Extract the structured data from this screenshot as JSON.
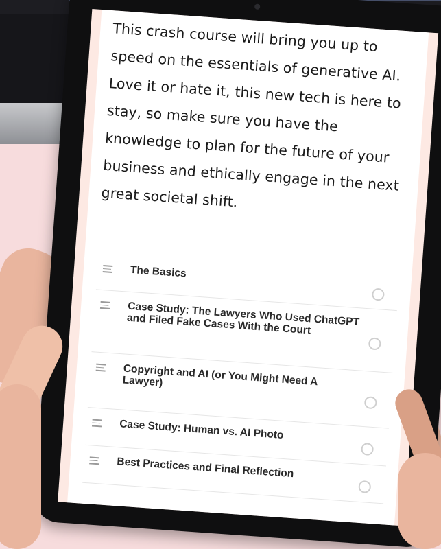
{
  "intro_text": "This crash course will bring you up to speed on the essentials of generative AI. Love it or hate it, this new tech is here to stay, so make sure you have the knowledge to plan for the future of your business and ethically engage in the next great societal shift.",
  "lessons": [
    {
      "title": "The Basics"
    },
    {
      "title": "Case Study: The Lawyers Who Used ChatGPT and Filed Fake Cases With the Court"
    },
    {
      "title": "Copyright and AI (or You Might Need A Lawyer)"
    },
    {
      "title": "Case Study: Human vs. AI Photo"
    },
    {
      "title": "Best Practices and Final Reflection"
    }
  ],
  "colors": {
    "background": "#f7dcdd",
    "screen_margin": "#fde9e3",
    "bezel": "#0f0f10"
  },
  "icons": {
    "drag": "drag-handle-icon",
    "status": "circle-outline-icon"
  }
}
